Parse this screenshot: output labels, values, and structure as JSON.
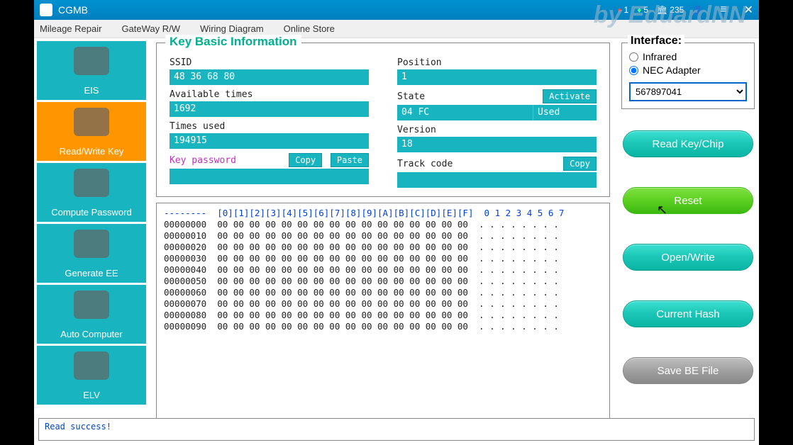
{
  "title": "CGMB",
  "watermark": "by EduardNN",
  "stats": {
    "red": "1",
    "green": "5",
    "currency": "235"
  },
  "menu": [
    "Mileage Repair",
    "GateWay R/W",
    "Wiring Diagram",
    "Online Store"
  ],
  "sidebar": [
    {
      "label": "EIS",
      "name": "eis"
    },
    {
      "label": "Read/Write Key",
      "name": "read-write-key",
      "active": true
    },
    {
      "label": "Compute Password",
      "name": "compute-password"
    },
    {
      "label": "Generate EE",
      "name": "generate-ee"
    },
    {
      "label": "Auto Computer",
      "name": "auto-computer"
    },
    {
      "label": "ELV",
      "name": "elv"
    }
  ],
  "keyinfo": {
    "title": "Key Basic Information",
    "left": {
      "ssid_label": "SSID",
      "ssid": "48 36 68 80",
      "avail_label": "Available times",
      "avail": "1692",
      "used_label": "Times used",
      "used": "194915",
      "keypw_label": "Key password",
      "keypw": "",
      "copy": "Copy",
      "paste": "Paste"
    },
    "right": {
      "pos_label": "Position",
      "pos": "1",
      "state_label": "State",
      "state": "04 FC",
      "state_used": "Used",
      "activate": "Activate",
      "ver_label": "Version",
      "ver": "18",
      "track_label": "Track code",
      "track": "",
      "copy": "Copy"
    }
  },
  "hex": {
    "header": "--------  [0][1][2][3][4][5][6][7][8][9][A][B][C][D][E][F]  0 1 2 3 4 5 6 7",
    "rows": [
      "00000000  00 00 00 00 00 00 00 00 00 00 00 00 00 00 00 00  . . . . . . . .",
      "00000010  00 00 00 00 00 00 00 00 00 00 00 00 00 00 00 00  . . . . . . . .",
      "00000020  00 00 00 00 00 00 00 00 00 00 00 00 00 00 00 00  . . . . . . . .",
      "00000030  00 00 00 00 00 00 00 00 00 00 00 00 00 00 00 00  . . . . . . . .",
      "00000040  00 00 00 00 00 00 00 00 00 00 00 00 00 00 00 00  . . . . . . . .",
      "00000050  00 00 00 00 00 00 00 00 00 00 00 00 00 00 00 00  . . . . . . . .",
      "00000060  00 00 00 00 00 00 00 00 00 00 00 00 00 00 00 00  . . . . . . . .",
      "00000070  00 00 00 00 00 00 00 00 00 00 00 00 00 00 00 00  . . . . . . . .",
      "00000080  00 00 00 00 00 00 00 00 00 00 00 00 00 00 00 00  . . . . . . . .",
      "00000090  00 00 00 00 00 00 00 00 00 00 00 00 00 00 00 00  . . . . . . . ."
    ]
  },
  "interface": {
    "title": "Interface:",
    "opt1": "Infrared",
    "opt2": "NEC Adapter",
    "selected": "567897041"
  },
  "actions": {
    "read": "Read Key/Chip",
    "reset": "Reset",
    "open": "Open/Write",
    "hash": "Current Hash",
    "save": "Save BE File"
  },
  "status": "Read success!"
}
